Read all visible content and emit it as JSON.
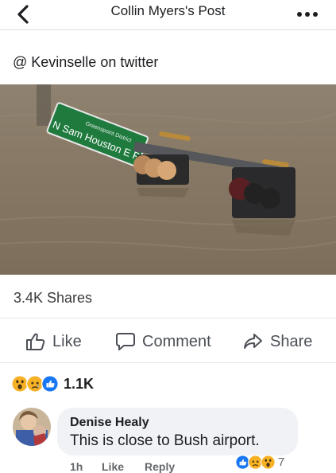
{
  "header": {
    "title": "Collin Myers's Post",
    "back_icon": "chevron-left-icon",
    "more_icon": "more-dots-icon"
  },
  "post": {
    "caption": "@ Kevinselle on twitter",
    "photo": {
      "sign_top_text": "Greenspoint District",
      "sign_main_text": "N Sam Houston E Pkwy"
    },
    "shares": "3.4K Shares"
  },
  "actions": {
    "like_label": "Like",
    "comment_label": "Comment",
    "share_label": "Share"
  },
  "reactions": {
    "icons": [
      "wow-reaction-icon",
      "sad-reaction-icon",
      "like-reaction-icon"
    ],
    "count": "1.1K"
  },
  "comment": {
    "author": "Denise Healy",
    "text": "This is close to Bush airport.",
    "time": "1h",
    "like_label": "Like",
    "reply_label": "Reply",
    "reaction_icons": [
      "like-reaction-icon",
      "sad-reaction-icon",
      "wow-reaction-icon"
    ],
    "reaction_count": "7"
  },
  "colors": {
    "text": "#1c1e21",
    "secondary_text": "#65676b",
    "like_blue": "#1877f2",
    "reaction_yellow": "#f7b125",
    "bubble_bg": "#f0f2f5",
    "floodwater": "#8a7a63"
  }
}
